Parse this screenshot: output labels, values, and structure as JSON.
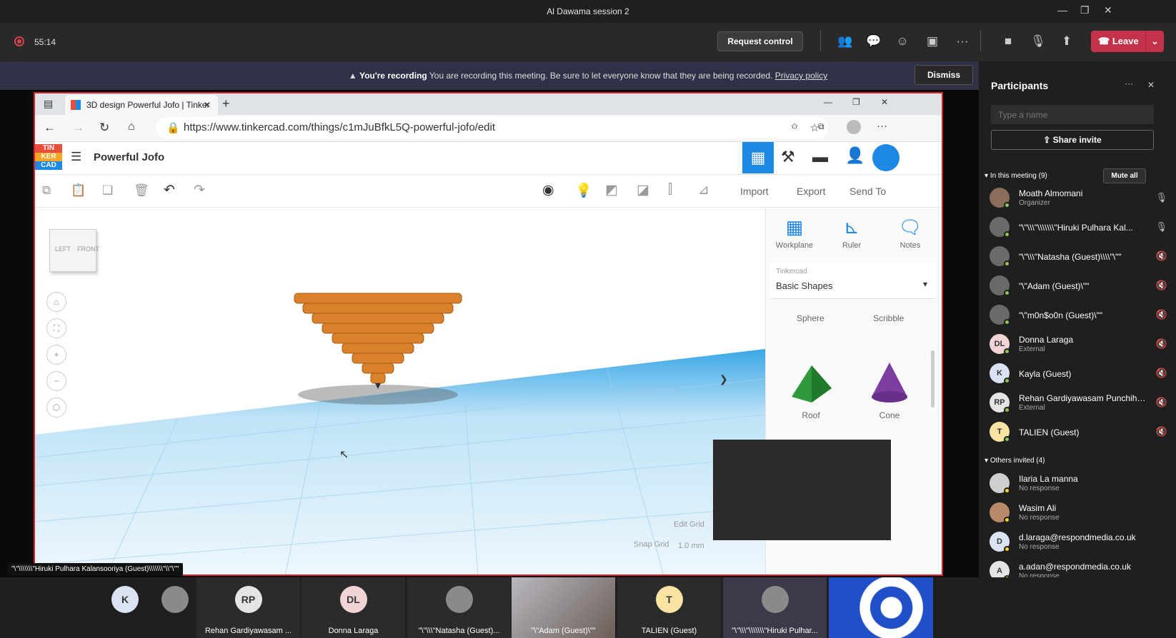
{
  "window": {
    "title": "Al Dawama session 2"
  },
  "toolbar": {
    "timer": "55:14",
    "request_control": "Request control",
    "leave": "Leave"
  },
  "banner": {
    "bold": "You're recording",
    "text": "You are recording this meeting. Be sure to let everyone know that they are being recorded.",
    "link": "Privacy policy",
    "dismiss": "Dismiss"
  },
  "browser": {
    "tab_title": "3D design Powerful Jofo | Tinker",
    "url": "https://www.tinkercad.com/things/c1mJuBfkL5Q-powerful-jofo/edit"
  },
  "tinkercad": {
    "logo": [
      "TIN",
      "KER",
      "CAD"
    ],
    "design_name": "Powerful Jofo",
    "actions": {
      "import": "Import",
      "export": "Export",
      "send_to": "Send To"
    },
    "panel_tools": {
      "workplane": "Workplane",
      "ruler": "Ruler",
      "notes": "Notes"
    },
    "library": {
      "label": "Tinkercad",
      "value": "Basic Shapes"
    },
    "shapes": {
      "sphere": "Sphere",
      "scribble": "Scribble",
      "roof": "Roof",
      "cone": "Cone"
    },
    "viewcube": {
      "left": "LEFT",
      "front": "FRONT"
    },
    "edit_grid": "Edit Grid",
    "snap_grid": "Snap Grid",
    "snap_value": "1.0 mm"
  },
  "caption": "\"\\\"\\\\\\\\\\\\\\\"Hiruki Pulhara Kalansooriya (Guest)\\\\\\\\\\\\\\\"\\\\\"\\\"\"",
  "participants": {
    "title": "Participants",
    "search_placeholder": "Type a name",
    "share_invite": "Share invite",
    "in_meeting": "In this meeting (9)",
    "mute_all": "Mute all",
    "members": [
      {
        "initials": "",
        "name": "Moath Almomani",
        "sub": "Organizer",
        "color": "#8a6d5b"
      },
      {
        "initials": "",
        "name": "\"\\\"\\\\\\\"\\\\\\\\\\\\\\\"Hiruki Pulhara Kal...",
        "sub": "",
        "color": "#6a6a6a"
      },
      {
        "initials": "",
        "name": "\"\\\"\\\\\\\"Natasha (Guest)\\\\\\\\\"\\\"\"",
        "sub": "",
        "color": "#6a6a6a"
      },
      {
        "initials": "",
        "name": "\"\\\"Adam (Guest)\\\"\"",
        "sub": "",
        "color": "#6a6a6a"
      },
      {
        "initials": "",
        "name": "\"\\\"m0n$o0n (Guest)\\\"\"",
        "sub": "",
        "color": "#6a6a6a"
      },
      {
        "initials": "DL",
        "name": "Donna Laraga",
        "sub": "External",
        "color": "#f2d4d7"
      },
      {
        "initials": "K",
        "name": "Kayla (Guest)",
        "sub": "",
        "color": "#dbe3f3"
      },
      {
        "initials": "RP",
        "name": "Rehan Gardiyawasam Punchihewa",
        "sub": "External",
        "color": "#e4e4e4"
      },
      {
        "initials": "T",
        "name": "TALIEN (Guest)",
        "sub": "",
        "color": "#f8e3a3"
      }
    ],
    "others_invited": "Others invited (4)",
    "invited": [
      {
        "initials": "",
        "name": "Ilaria La manna",
        "sub": "No response",
        "color": "#cfcfcf"
      },
      {
        "initials": "",
        "name": "Wasim Ali",
        "sub": "No response",
        "color": "#b98a6a"
      },
      {
        "initials": "D",
        "name": "d.laraga@respondmedia.co.uk",
        "sub": "No response",
        "color": "#dbe3f3"
      },
      {
        "initials": "A",
        "name": "a.adan@respondmedia.co.uk",
        "sub": "No response",
        "color": "#e4e4e4"
      }
    ]
  },
  "gallery": [
    {
      "label": "",
      "initials": "K",
      "color": "#dbe3f3"
    },
    {
      "label": "",
      "initials": "",
      "color": "#8a8a8a"
    },
    {
      "label": "Rehan Gardiyawasam ...",
      "initials": "RP",
      "color": "#e4e4e4"
    },
    {
      "label": "Donna Laraga",
      "initials": "DL",
      "color": "#f2d4d7"
    },
    {
      "label": "\"\\\"\\\\\\\"Natasha (Guest)...",
      "initials": "",
      "color": "#8a8a8a"
    },
    {
      "label": "\"\\\"Adam (Guest)\\\"\"",
      "initials": "",
      "color": ""
    },
    {
      "label": "TALIEN (Guest)",
      "initials": "T",
      "color": "#f8e3a3"
    },
    {
      "label": "\"\\\"\\\\\\\"\\\\\\\\\\\\\\\"Hiruki Pulhar...",
      "initials": "",
      "color": "#8a8a8a"
    }
  ]
}
